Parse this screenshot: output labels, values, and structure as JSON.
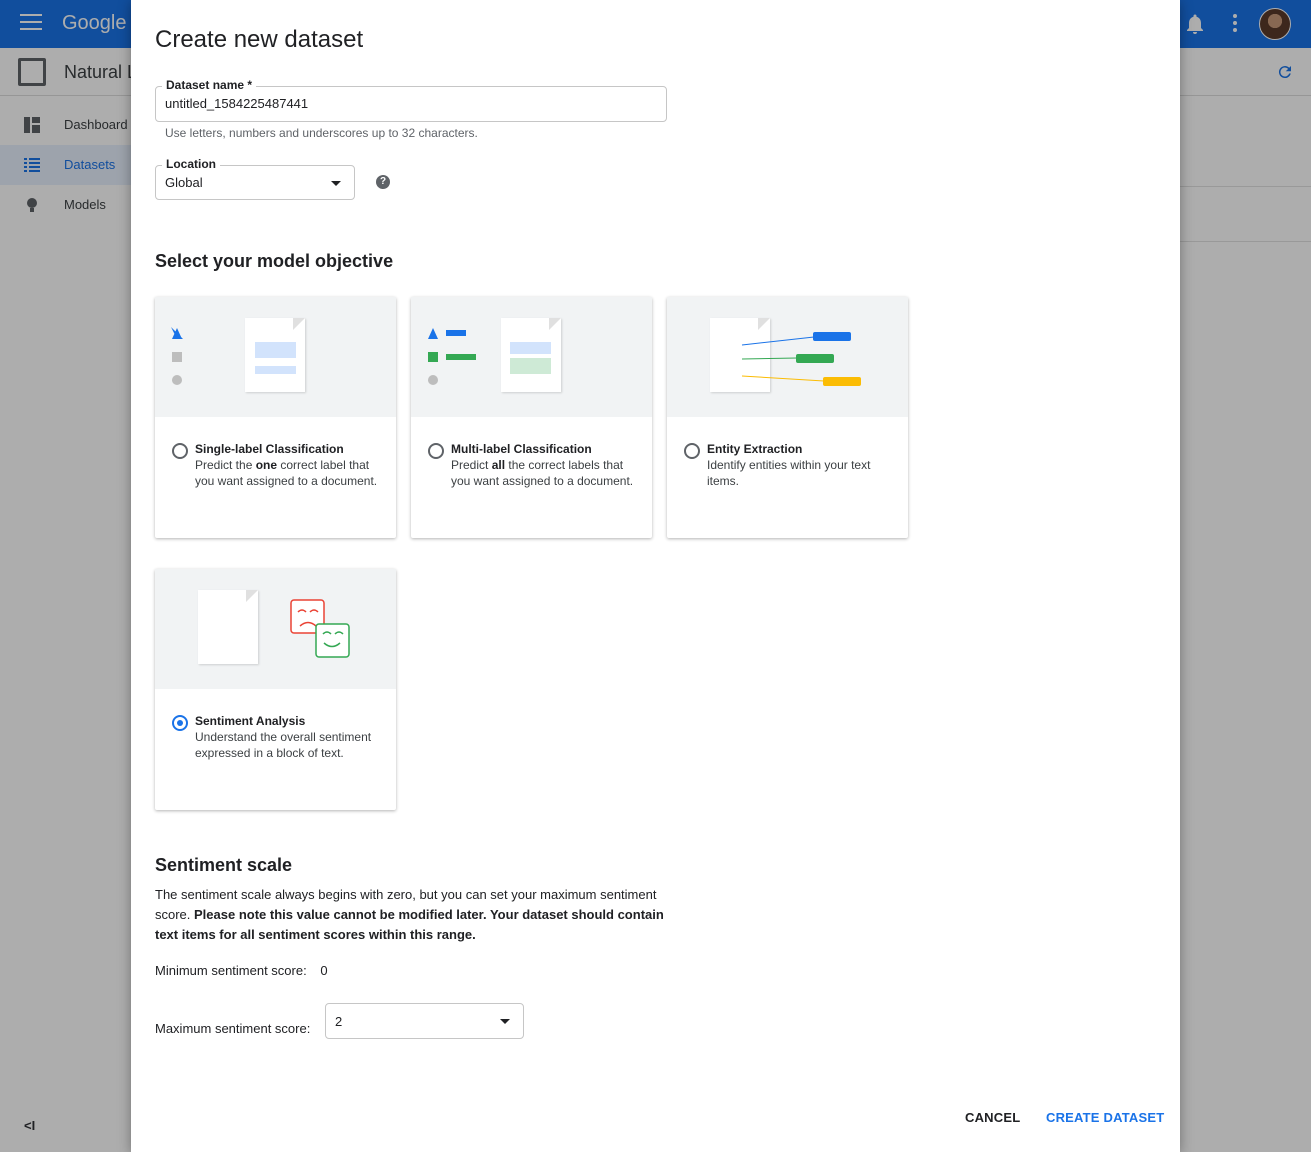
{
  "app": {
    "logo_text": "Google C",
    "product_name": "Natural L",
    "nav": [
      {
        "label": "Dashboard",
        "icon": "dashboard-icon"
      },
      {
        "label": "Datasets",
        "icon": "list-icon",
        "active": true
      },
      {
        "label": "Models",
        "icon": "lightbulb-icon"
      }
    ],
    "collapse_label": "<I"
  },
  "dialog": {
    "title": "Create new dataset",
    "dataset_name": {
      "label": "Dataset name *",
      "value": "untitled_1584225487441",
      "hint": "Use letters, numbers and underscores up to 32 characters."
    },
    "location": {
      "label": "Location",
      "value": "Global",
      "help_icon": "help-icon"
    },
    "objective_heading": "Select your model objective",
    "objectives": [
      {
        "title": "Single-label Classification",
        "desc_pre": "Predict the ",
        "desc_bold": "one",
        "desc_post": " correct label that you want assigned to a document.",
        "selected": false
      },
      {
        "title": "Multi-label Classification",
        "desc_pre": "Predict ",
        "desc_bold": "all",
        "desc_post": " the correct labels that you want assigned to a document.",
        "selected": false
      },
      {
        "title": "Entity Extraction",
        "desc_pre": "Identify entities within your text items.",
        "desc_bold": "",
        "desc_post": "",
        "selected": false
      },
      {
        "title": "Sentiment Analysis",
        "desc_pre": "Understand the overall sentiment expressed in a block of text.",
        "desc_bold": "",
        "desc_post": "",
        "selected": true
      }
    ],
    "sentiment": {
      "heading": "Sentiment scale",
      "text_plain": "The sentiment scale always begins with zero, but you can set your maximum sentiment score. ",
      "text_bold": "Please note this value cannot be modified later. Your dataset should contain text items for all sentiment scores within this range.",
      "min_label": "Minimum sentiment score:",
      "min_value": "0",
      "max_label": "Maximum sentiment score:",
      "max_value": "2"
    },
    "buttons": {
      "cancel": "CANCEL",
      "create": "CREATE DATASET"
    }
  },
  "colors": {
    "brand_blue": "#1a73e8",
    "green": "#34a853",
    "yellow": "#fbbc04",
    "red": "#ea4335"
  }
}
